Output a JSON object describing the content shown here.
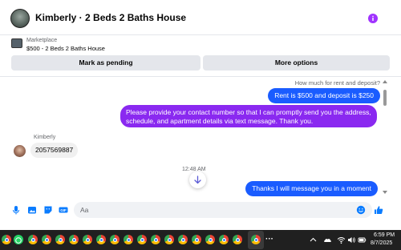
{
  "header": {
    "title": "Kimberly · 2 Beds 2 Baths House"
  },
  "listing": {
    "label": "Marketplace",
    "item": "$500 - 2 Beds 2 Baths House",
    "pending_button": "Mark as pending",
    "more_button": "More options"
  },
  "messages": {
    "reply_hint": "How much for rent and deposit?",
    "m1": "Rent is $500 and deposit is $250",
    "m2": "Please provide your contact number so that I can promptly send you the address, schedule, and apartment details via text message. Thank you.",
    "sender_name": "Kimberly",
    "m3": "2057569887",
    "timestamp": "12:48 AM",
    "m4": "Thanks I will message you in a moment"
  },
  "composer": {
    "placeholder": "Aa"
  },
  "taskbar": {
    "time": "6:59 PM",
    "date": "8/7/2025"
  },
  "colors": {
    "outgoing_blue": "#1a5cff",
    "outgoing_purple": "#8a29f0",
    "accent_blue": "#0a7cff",
    "info_purple": "#a033ff"
  },
  "icons": {
    "header": [
      "avatar",
      "info-icon"
    ],
    "composer": [
      "microphone-icon",
      "image-icon",
      "sticker-icon",
      "gif-icon",
      "emoji-icon",
      "like-icon"
    ],
    "taskbar": [
      "chrome-icon",
      "whatsapp-icon",
      "more-icon",
      "chevron-up-icon",
      "onedrive-icon",
      "wifi-icon",
      "volume-icon",
      "battery-icon"
    ]
  }
}
